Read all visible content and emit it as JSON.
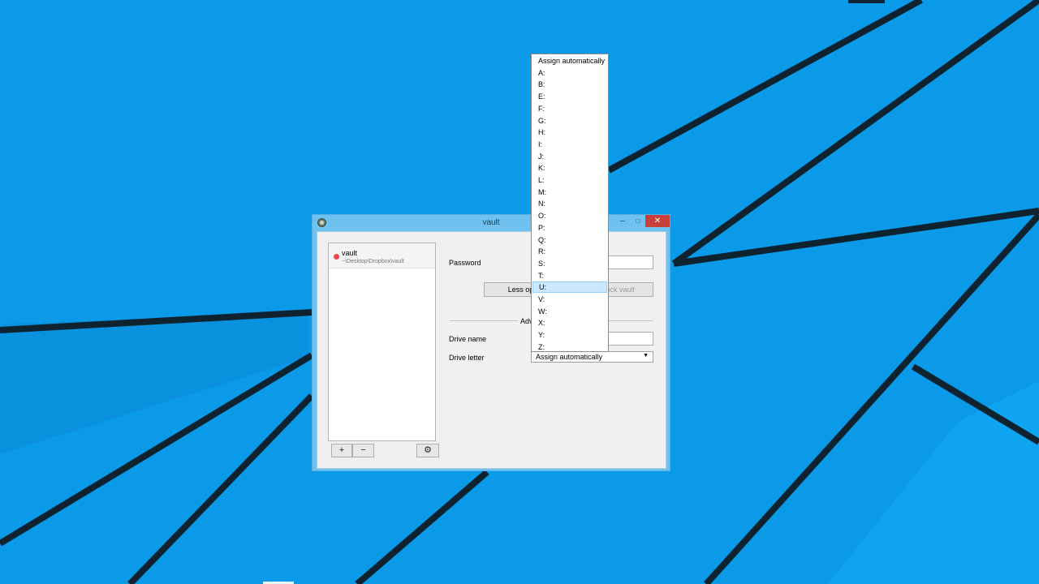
{
  "window": {
    "title": "vault",
    "controls": {
      "minimize": "–",
      "maximize": "□",
      "close": "✕"
    }
  },
  "vault_list": {
    "items": [
      {
        "name": "vault",
        "path": "~\\Desktop\\Dropbox\\vault",
        "status_color": "#f04848"
      }
    ],
    "add_label": "+",
    "remove_label": "−",
    "settings_icon": "gear-icon"
  },
  "form": {
    "password_label": "Password",
    "password_value": "",
    "less_options_label": "Less options",
    "unlock_label": "Unlock vault",
    "section_title": "Advanced settings",
    "drive_name_label": "Drive name",
    "drive_name_value": "",
    "drive_letter_label": "Drive letter",
    "drive_letter_value": "Assign automatically"
  },
  "dropdown": {
    "highlighted": "U:",
    "options": [
      "Assign automatically",
      "A:",
      "B:",
      "E:",
      "F:",
      "G:",
      "H:",
      "I:",
      "J:",
      "K:",
      "L:",
      "M:",
      "N:",
      "O:",
      "P:",
      "Q:",
      "R:",
      "S:",
      "T:",
      "U:",
      "V:",
      "W:",
      "X:",
      "Y:",
      "Z:"
    ]
  },
  "colors": {
    "desktop": "#0a9ae8",
    "titlebar": "#6fc2f0",
    "close_button": "#c7413a",
    "highlight": "#cce8ff"
  }
}
